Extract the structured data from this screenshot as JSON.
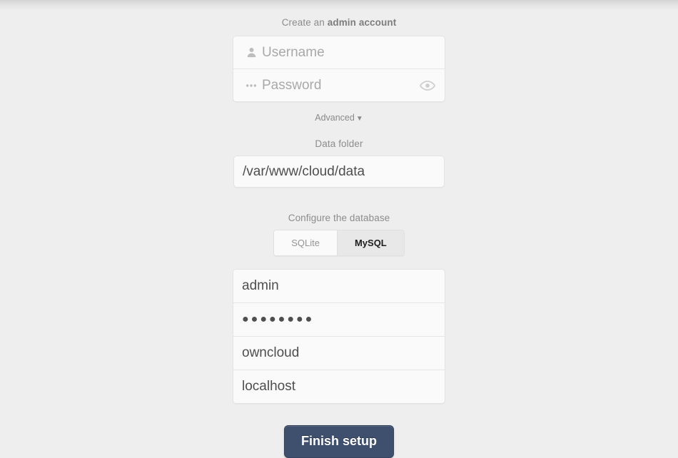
{
  "admin_section": {
    "caption_prefix": "Create an ",
    "caption_strong": "admin account",
    "username": {
      "placeholder": "Username",
      "value": "",
      "icon": "user-icon"
    },
    "password": {
      "placeholder": "Password",
      "value": "",
      "icon": "dots-icon",
      "toggle_icon": "eye-icon"
    }
  },
  "advanced": {
    "label": "Advanced",
    "caret": "▼"
  },
  "data_folder": {
    "label": "Data folder",
    "value": "/var/www/cloud/data"
  },
  "database": {
    "caption": "Configure the database",
    "types": [
      {
        "label": "SQLite",
        "selected": false
      },
      {
        "label": "MySQL",
        "selected": true
      }
    ],
    "fields": [
      {
        "name": "db-user",
        "value": "admin",
        "masked": false
      },
      {
        "name": "db-password",
        "value": "●●●●●●●●",
        "masked": true
      },
      {
        "name": "db-name",
        "value": "owncloud",
        "masked": false
      },
      {
        "name": "db-host",
        "value": "localhost",
        "masked": false
      }
    ]
  },
  "finish_button": {
    "label": "Finish setup"
  },
  "colors": {
    "page_background": "#eeeeee",
    "field_background": "#fafafa",
    "label_text": "#8c8c8c",
    "value_text": "#4e4e4e",
    "placeholder_text": "#a9a9a9",
    "button_background": "#3f4f6e",
    "button_text": "#ffffff",
    "active_tab_background": "#e8e8e8"
  }
}
